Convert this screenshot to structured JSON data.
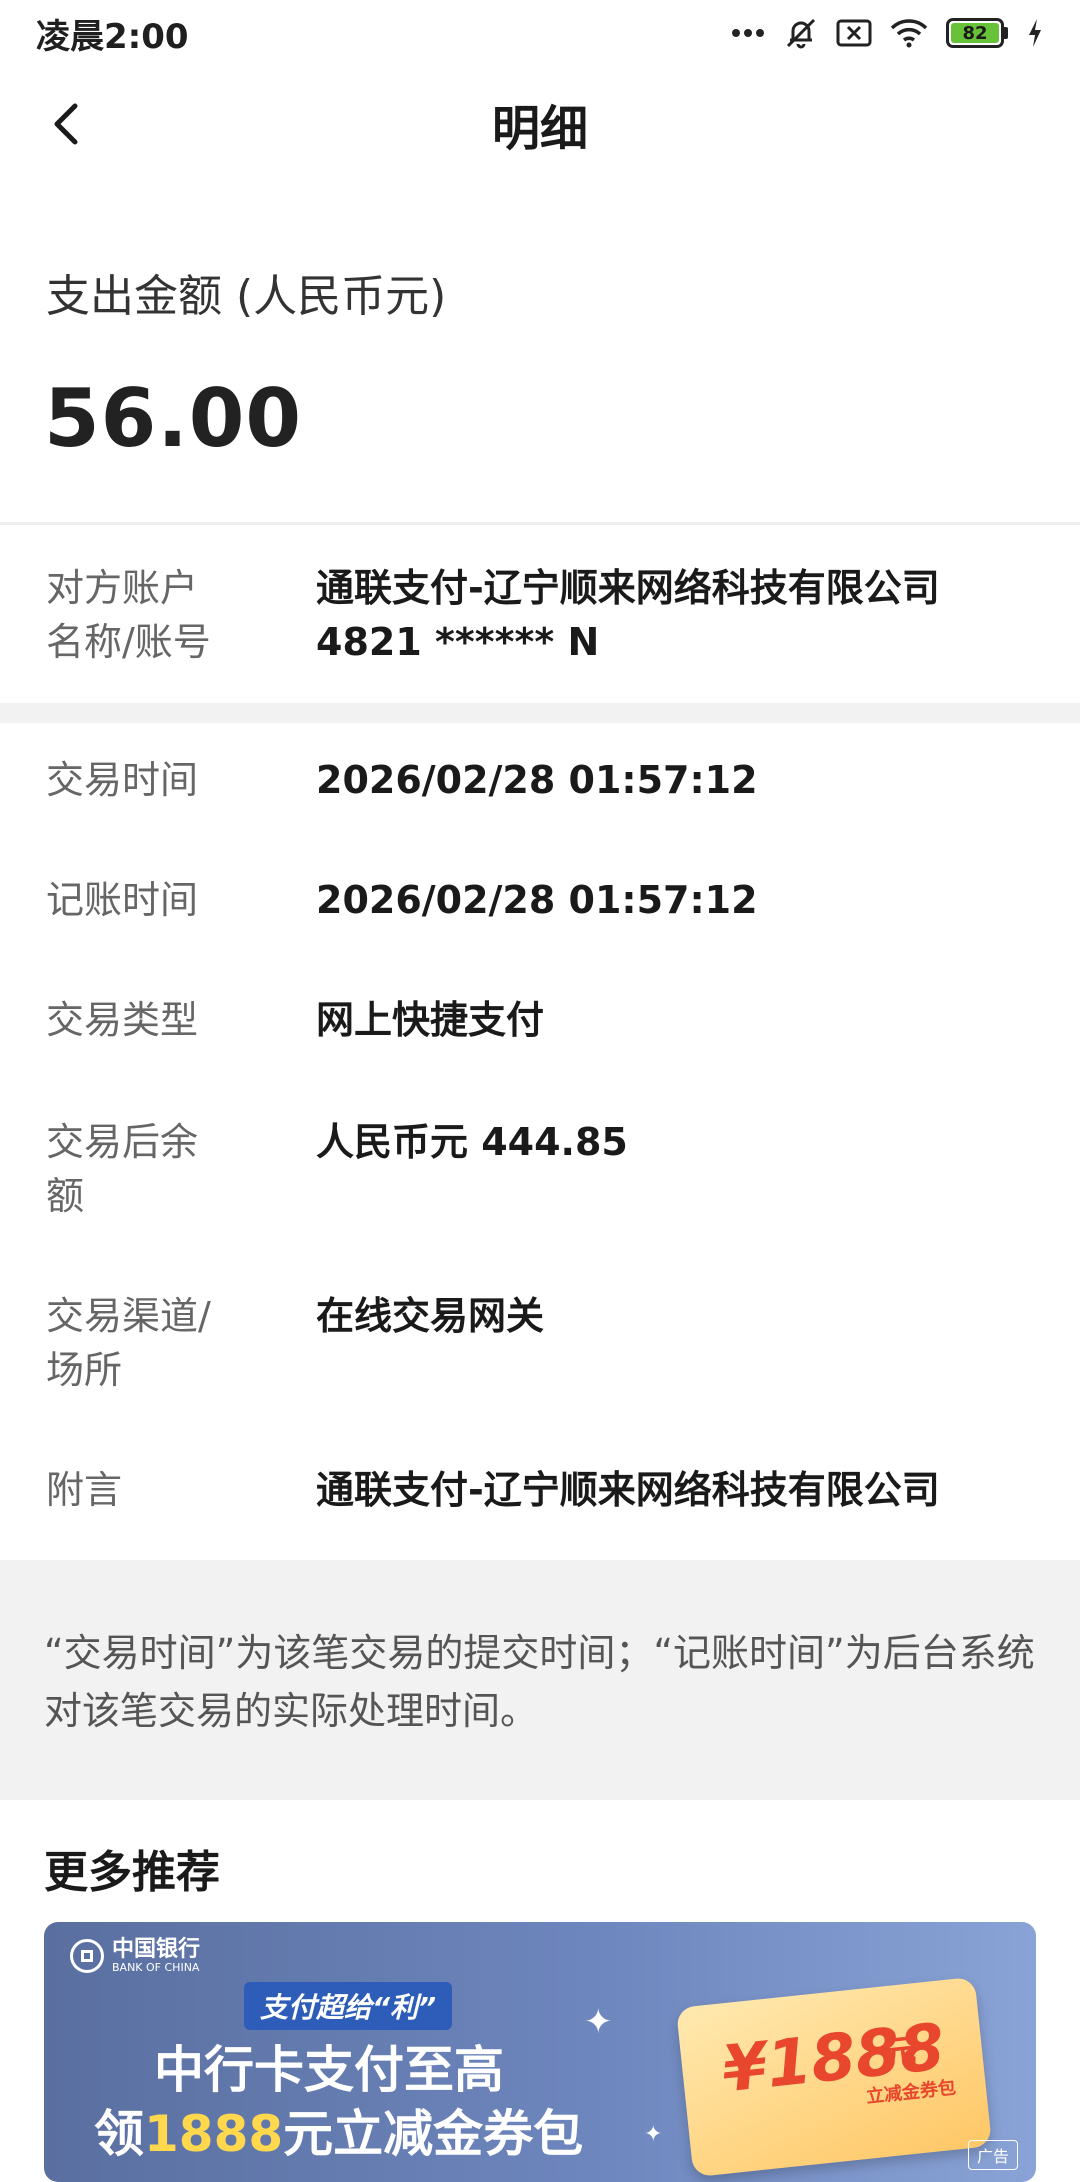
{
  "status_bar": {
    "time": "凌晨2:00",
    "battery_level": "82"
  },
  "nav": {
    "title": "明细"
  },
  "amount": {
    "label": "支出金额 (人民币元)",
    "value": "56.00"
  },
  "counterparty": {
    "label_line1": "对方账户",
    "label_line2": "名称/账号",
    "name": "通联支付-辽宁顺来网络科技有限公司",
    "account": "4821 ****** N"
  },
  "details": [
    {
      "label_line1": "交易时间",
      "label_line2": "",
      "value": "2026/02/28 01:57:12"
    },
    {
      "label_line1": "记账时间",
      "label_line2": "",
      "value": "2026/02/28 01:57:12"
    },
    {
      "label_line1": "交易类型",
      "label_line2": "",
      "value": "网上快捷支付"
    },
    {
      "label_line1": "交易后余",
      "label_line2": "额",
      "value": "人民币元 444.85"
    },
    {
      "label_line1": "交易渠道/",
      "label_line2": "场所",
      "value": "在线交易网关"
    },
    {
      "label_line1": "附言",
      "label_line2": "",
      "value": "通联支付-辽宁顺来网络科技有限公司"
    }
  ],
  "note": {
    "text": "“交易时间”为该笔交易的提交时间；“记账时间”为后台系统对该笔交易的实际处理时间。"
  },
  "more": {
    "title": "更多推荐",
    "banner": {
      "bank_name": "中国银行",
      "bank_name_en": "BANK OF CHINA",
      "tag": "支付超给“利”",
      "line1": "中行卡支付至高",
      "line2_pre": "领",
      "line2_highlight": "1888",
      "line2_post": "元立减金券包",
      "coupon_amount": "¥1888",
      "coupon_unit": "元",
      "coupon_sub": "立减金券包",
      "ad_label": "广告"
    }
  },
  "colors": {
    "accent_green": "#67c23a",
    "banner_blue": "#6d86bd",
    "highlight_yellow": "#ffd84d",
    "coupon_red": "#e8472e"
  }
}
